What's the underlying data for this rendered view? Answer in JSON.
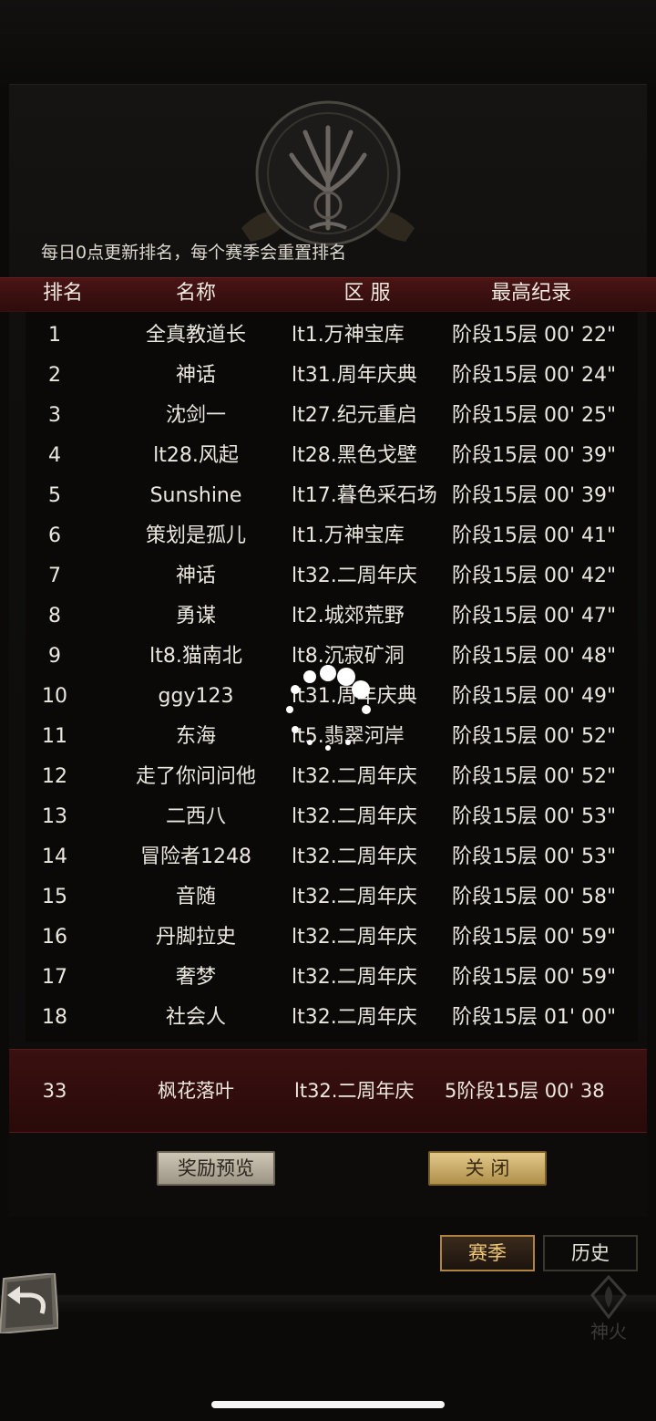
{
  "notice": "每日0点更新排名，每个赛季会重置排名",
  "header": {
    "rank": "排名",
    "name": "名称",
    "server": "区 服",
    "record": "最高纪录"
  },
  "rows": [
    {
      "rank": "1",
      "name": "全真教道长",
      "server": "lt1.万神宝库",
      "record": "阶段15层  00' 22\""
    },
    {
      "rank": "2",
      "name": "神话",
      "server": "lt31.周年庆典",
      "record": "阶段15层  00' 24\""
    },
    {
      "rank": "3",
      "name": "沈剑一",
      "server": "lt27.纪元重启",
      "record": "阶段15层  00' 25\""
    },
    {
      "rank": "4",
      "name": "lt28.风起",
      "server": "lt28.黑色戈壁",
      "record": "阶段15层  00' 39\""
    },
    {
      "rank": "5",
      "name": "Sunshine",
      "server": "lt17.暮色采石场",
      "record": "阶段15层  00' 39\""
    },
    {
      "rank": "6",
      "name": "策划是孤儿",
      "server": "lt1.万神宝库",
      "record": "阶段15层  00' 41\""
    },
    {
      "rank": "7",
      "name": "神话",
      "server": "lt32.二周年庆",
      "record": "阶段15层  00' 42\""
    },
    {
      "rank": "8",
      "name": "勇谋",
      "server": "lt2.城郊荒野",
      "record": "阶段15层  00' 47\""
    },
    {
      "rank": "9",
      "name": "lt8.猫南北",
      "server": "lt8.沉寂矿洞",
      "record": "阶段15层  00' 48\""
    },
    {
      "rank": "10",
      "name": "ggy123",
      "server": "lt31.周年庆典",
      "record": "阶段15层  00' 49\""
    },
    {
      "rank": "11",
      "name": "东海",
      "server": "lt5.翡翠河岸",
      "record": "阶段15层  00' 52\""
    },
    {
      "rank": "12",
      "name": "走了你问问他",
      "server": "lt32.二周年庆",
      "record": "阶段15层  00' 52\""
    },
    {
      "rank": "13",
      "name": "二西八",
      "server": "lt32.二周年庆",
      "record": "阶段15层  00' 53\""
    },
    {
      "rank": "14",
      "name": "冒险者1248",
      "server": "lt32.二周年庆",
      "record": "阶段15层  00' 53\""
    },
    {
      "rank": "15",
      "name": "音随",
      "server": "lt32.二周年庆",
      "record": "阶段15层  00' 58\""
    },
    {
      "rank": "16",
      "name": "丹脚拉史",
      "server": "lt32.二周年庆",
      "record": "阶段15层  00' 59\""
    },
    {
      "rank": "17",
      "name": "奢梦",
      "server": "lt32.二周年庆",
      "record": "阶段15层  00' 59\""
    },
    {
      "rank": "18",
      "name": "社会人",
      "server": "lt32.二周年庆",
      "record": "阶段15层  01' 00\""
    }
  ],
  "my_rank": {
    "rank": "33",
    "name": "枫花落叶",
    "server": "lt32.二周年庆",
    "record": "5阶段15层  00' 38"
  },
  "buttons": {
    "reward_preview": "奖励预览",
    "close": "关 闭"
  },
  "tabs": {
    "season": "赛季",
    "history": "历史"
  },
  "corner_label": "神火",
  "icons": {
    "back": "back-arrow-icon",
    "emblem": "tree-emblem-icon",
    "spinner": "loading-spinner-icon",
    "divine_fire": "divine-fire-icon"
  },
  "colors": {
    "header_bar": "#4a1414",
    "my_row": "#3a1010",
    "close_button": "#e2c88a",
    "season_tab_border": "#b08440"
  }
}
